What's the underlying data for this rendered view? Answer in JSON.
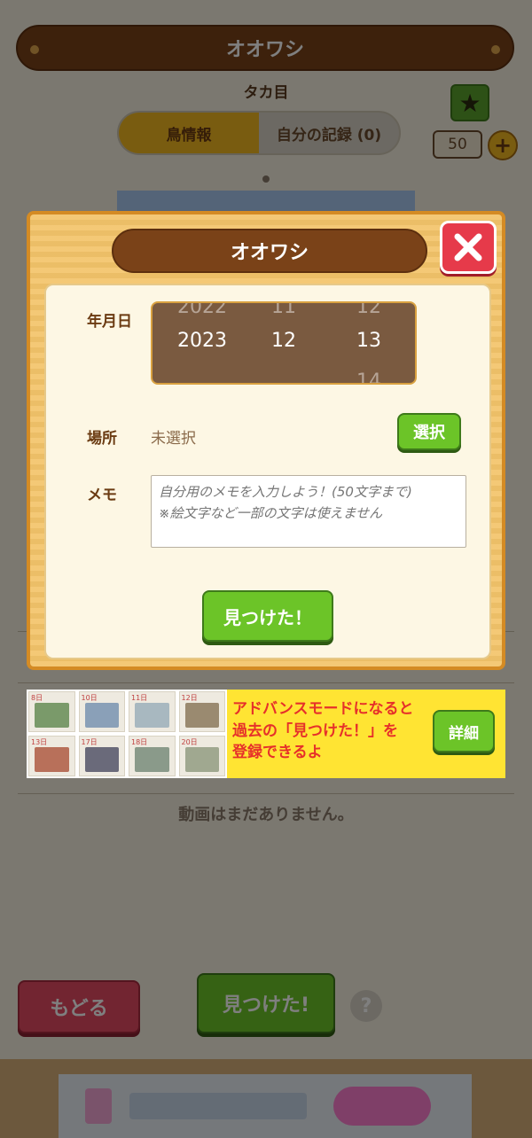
{
  "background": {
    "title": "オオワシ",
    "order": "タカ目",
    "tabs": [
      {
        "label": "鳥情報",
        "active": true
      },
      {
        "label": "自分の記録 (0)",
        "active": false
      }
    ],
    "star_icon": "star-icon",
    "count": "50",
    "plus_icon": "plus-icon",
    "no_videos": "動画はまだありません。",
    "back_label": "もどる",
    "found_label": "見つけた!",
    "help_label": "?"
  },
  "modal": {
    "title": "オオワシ",
    "close_icon": "close-icon",
    "date_label": "年月日",
    "picker": {
      "year": {
        "prev": "2022",
        "current": "2023",
        "next": ""
      },
      "month": {
        "prev": "11",
        "current": "12",
        "next": ""
      },
      "day": {
        "prev": "12",
        "current": "13",
        "next": "14"
      }
    },
    "place_label": "場所",
    "place_value": "未選択",
    "select_label": "選択",
    "memo_label": "メモ",
    "memo_placeholder": "自分用のメモを入力しよう！(50文字まで)\n※絵文字など一部の文字は使えません",
    "memo_value": "",
    "found_label": "見つけた！"
  },
  "promo": {
    "days": [
      "8日",
      "10日",
      "11日",
      "12日",
      "13日",
      "17日",
      "18日",
      "20日"
    ],
    "text_line1": "アドバンスモードになると",
    "text_line2": "過去の「見つけた！」を",
    "text_line3": "登録できるよ",
    "detail_label": "詳細"
  },
  "colors": {
    "wood_dark": "#7a4218",
    "green_button": "#6cc428",
    "red_button": "#e63a4a",
    "promo_yellow": "#ffe433",
    "promo_text": "#e6302a"
  }
}
